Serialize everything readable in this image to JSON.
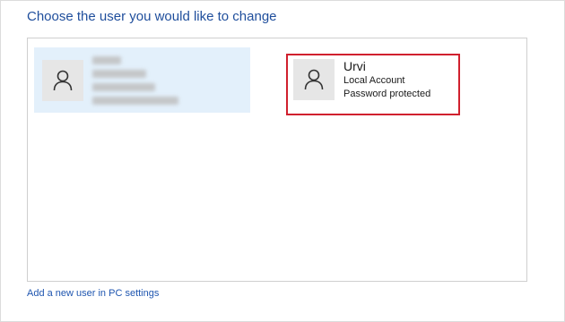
{
  "heading": "Choose the user you would like to change",
  "users": [
    {
      "name": "",
      "account_type": "",
      "status": "",
      "icon": "user-icon",
      "selected": true,
      "details_redacted": true
    },
    {
      "name": "Urvi",
      "account_type": "Local Account",
      "status": "Password protected",
      "icon": "user-icon",
      "selected": false,
      "highlighted": true
    }
  ],
  "add_user_link": "Add a new user in PC settings",
  "colors": {
    "heading": "#1f4e9c",
    "selected_tile": "#e3f0fb",
    "highlight_border": "#d0202e",
    "link": "#1f56b0"
  }
}
